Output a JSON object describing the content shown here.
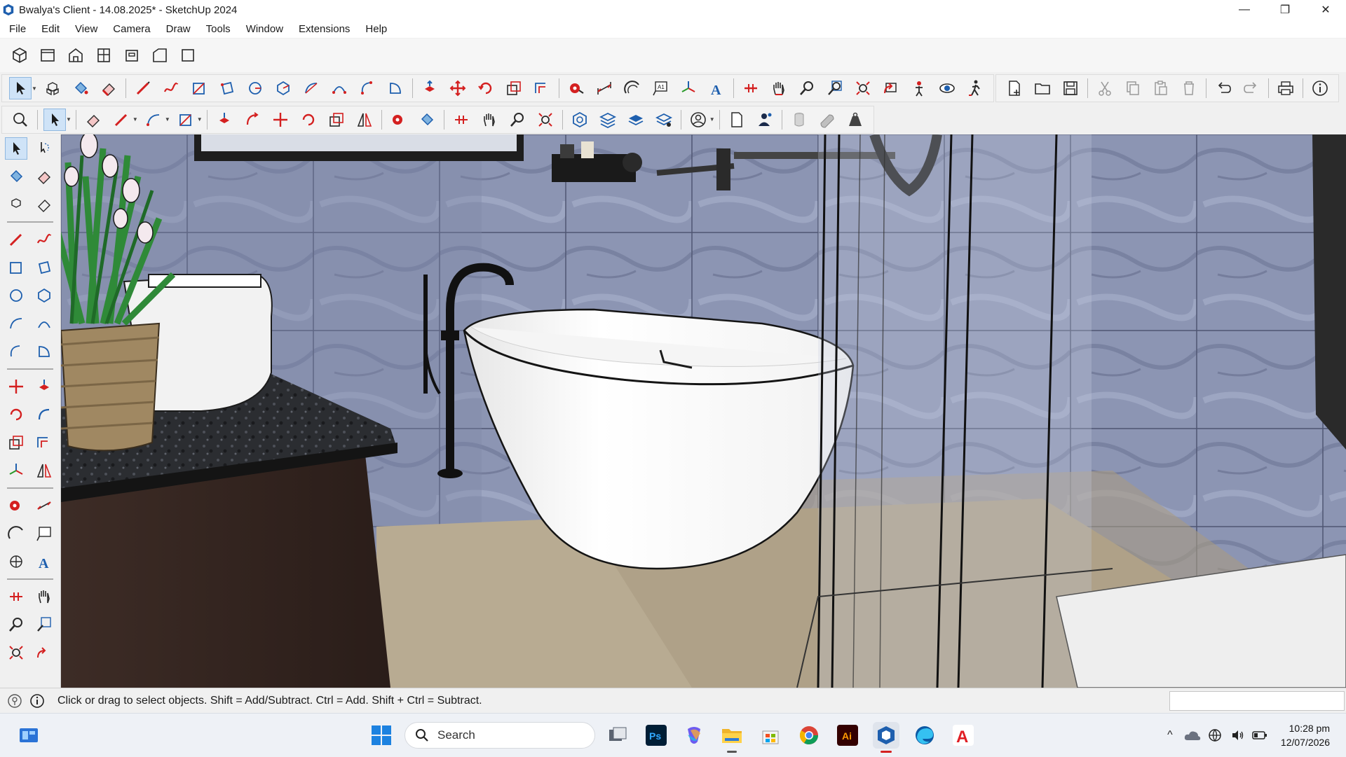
{
  "window": {
    "title": "Bwalya's Client - 14.08.2025* - SketchUp 2024",
    "controls": [
      "—",
      "❐",
      "✕"
    ]
  },
  "menu": [
    "File",
    "Edit",
    "View",
    "Camera",
    "Draw",
    "Tools",
    "Window",
    "Extensions",
    "Help"
  ],
  "status": {
    "hint": "Click or drag to select objects. Shift = Add/Subtract. Ctrl = Add. Shift + Ctrl = Subtract.",
    "measurements": ""
  },
  "taskbar": {
    "search_label": "Search",
    "clock_time": "10:28 pm",
    "clock_date": "12/07/2026",
    "apps": [
      "file-explorer-taskview",
      "photoshop",
      "copilot",
      "file-explorer",
      "microsoft-store",
      "chrome",
      "illustrator",
      "sketchup",
      "edge",
      "acrobat"
    ]
  },
  "colors": {
    "accent_red": "#d42020",
    "accent_blue": "#1e5fae",
    "tile_base": "#8a93b0",
    "floor": "#b8ab92"
  }
}
